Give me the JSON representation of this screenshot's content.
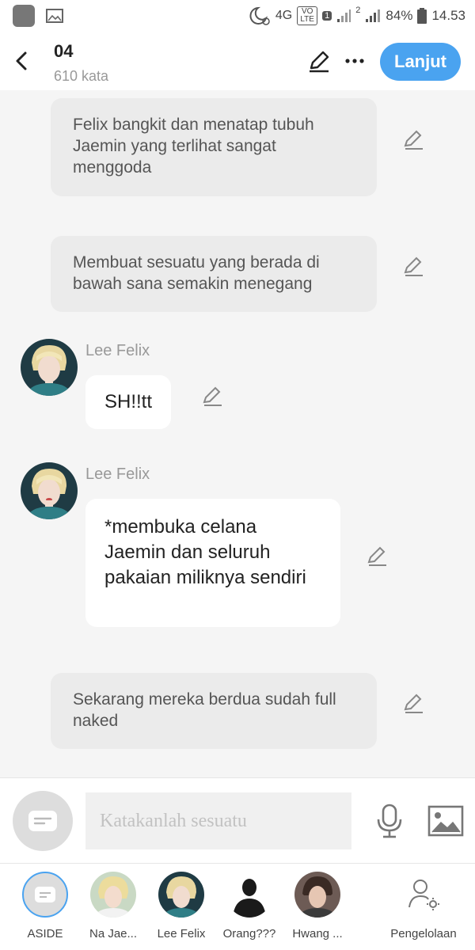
{
  "status_bar": {
    "network": "4G",
    "volte": "VO LTE",
    "sim_badge": "1",
    "sim2": "2",
    "battery": "84%",
    "time": "14.53"
  },
  "header": {
    "title": "04",
    "word_count": "610 kata",
    "next_label": "Lanjut"
  },
  "messages": {
    "narration_1": "Felix bangkit dan menatap tubuh Jaemin yang terlihat sangat menggoda",
    "narration_2": "Membuat sesuatu yang berada di bawah sana semakin menegang",
    "speaker_1": "Lee Felix",
    "bubble_1": "SH!!tt",
    "speaker_2": "Lee Felix",
    "bubble_2": "*membuka celana Jaemin dan seluruh pakaian miliknya sendiri",
    "narration_3": "Sekarang mereka berdua sudah full naked"
  },
  "composer": {
    "placeholder": "Katakanlah sesuatu"
  },
  "characters": {
    "aside": "ASIDE",
    "char_1": "Na Jae...",
    "char_2": "Lee Felix",
    "char_3": "Orang???",
    "char_4": "Hwang ...",
    "manage": "Pengelolaan"
  },
  "colors": {
    "accent": "#4aa3f0",
    "narration_bg": "#ebebeb",
    "chat_bg": "#f5f5f5"
  }
}
